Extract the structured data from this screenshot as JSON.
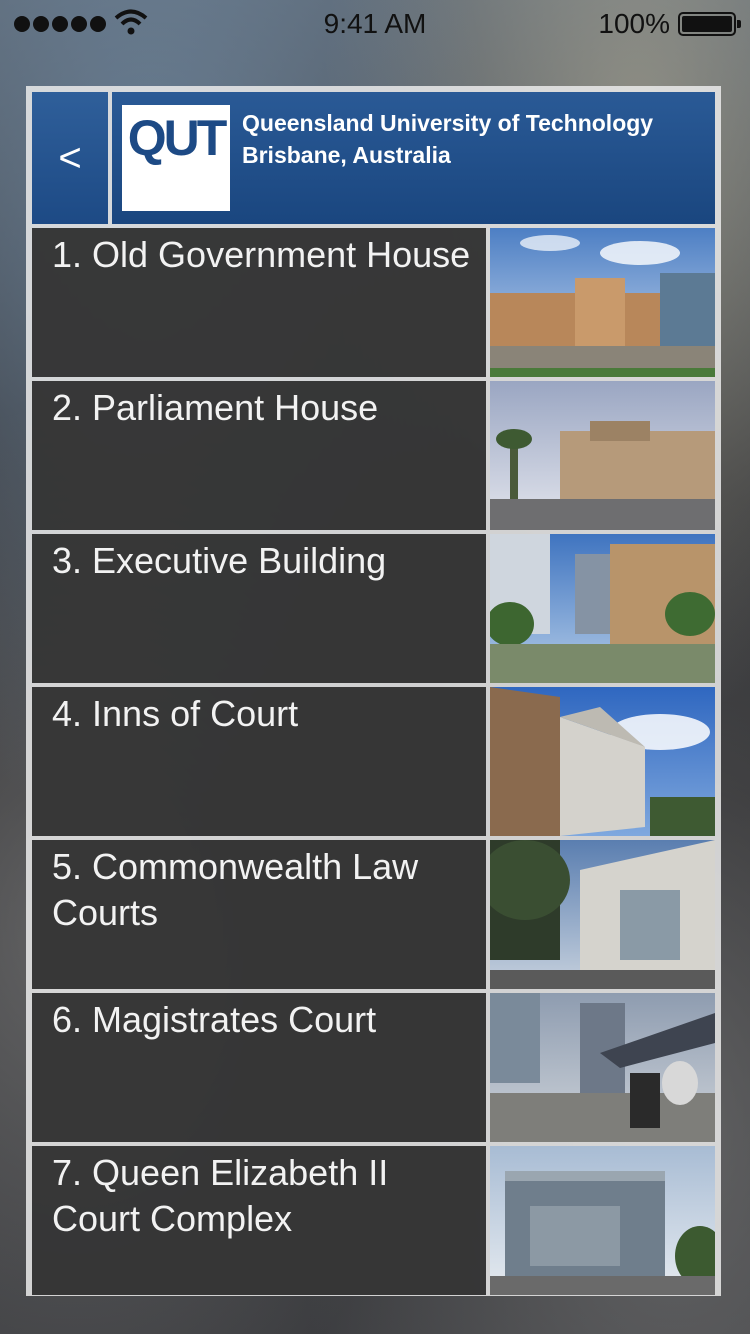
{
  "status_bar": {
    "time": "9:41 AM",
    "battery_percent": "100%",
    "signal_icon": "signal-dots-icon",
    "wifi_icon": "wifi-icon",
    "battery_icon": "battery-icon"
  },
  "header": {
    "back_label": "<",
    "logo_text": "QUT",
    "title_line1": "Queensland University of Technology",
    "title_line2": "Brisbane, Australia",
    "brand_color": "#1d4a85"
  },
  "locations": [
    {
      "label": "1. Old Government House",
      "thumbnail": "old-government-house-photo"
    },
    {
      "label": "2. Parliament House",
      "thumbnail": "parliament-house-photo"
    },
    {
      "label": "3. Executive Building",
      "thumbnail": "executive-building-photo"
    },
    {
      "label": "4. Inns of Court",
      "thumbnail": "inns-of-court-photo"
    },
    {
      "label": "5. Commonwealth Law Courts",
      "thumbnail": "commonwealth-law-courts-photo"
    },
    {
      "label": "6. Magistrates Court",
      "thumbnail": "magistrates-court-photo"
    },
    {
      "label": "7. Queen Elizabeth II Court Complex",
      "thumbnail": "queen-elizabeth-ii-court-complex-photo"
    }
  ]
}
